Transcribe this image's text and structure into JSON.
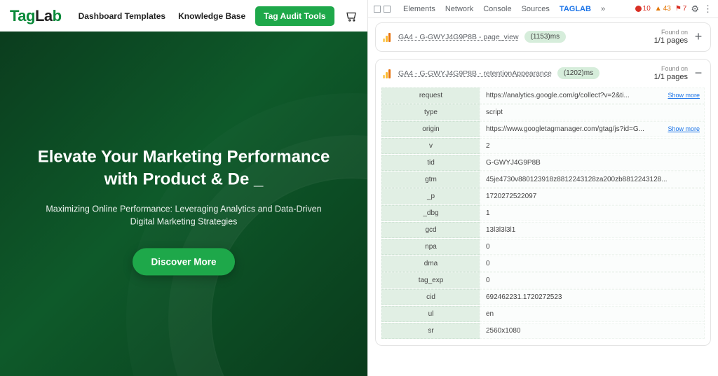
{
  "left": {
    "logo_parts": {
      "a": "Tag",
      "b": "La",
      "c": "b"
    },
    "nav": [
      {
        "label": "Dashboard Templates"
      },
      {
        "label": "Knowledge Base"
      }
    ],
    "cta": "Tag Audit Tools",
    "hero_title": "Elevate Your Marketing Performance with Product & De _",
    "hero_sub": "Maximizing Online Performance: Leveraging Analytics and Data-Driven Digital Marketing Strategies",
    "hero_btn": "Discover More"
  },
  "devtools": {
    "tabs": [
      "Elements",
      "Network",
      "Console",
      "Sources",
      "TAGLAB"
    ],
    "active_tab": 4,
    "badges": {
      "errors": "10",
      "warnings": "43",
      "issues": "7"
    }
  },
  "cards": [
    {
      "title": "GA4 - G-GWYJ4G9P8B - page_view",
      "timing": "(1153)ms",
      "found_label": "Found on",
      "found_val": "1/1 pages",
      "expanded": false
    },
    {
      "title": "GA4 - G-GWYJ4G9P8B - retentionAppearance",
      "timing": "(1202)ms",
      "found_label": "Found on",
      "found_val": "1/1 pages",
      "expanded": true,
      "rows": [
        {
          "k": "request",
          "v": "https://analytics.google.com/g/collect?v=2&ti...",
          "more": true
        },
        {
          "k": "type",
          "v": "script"
        },
        {
          "k": "origin",
          "v": "https://www.googletagmanager.com/gtag/js?id=G...",
          "more": true
        },
        {
          "k": "v",
          "v": "2"
        },
        {
          "k": "tid",
          "v": "G-GWYJ4G9P8B"
        },
        {
          "k": "gtm",
          "v": "45je4730v880123918z8812243128za200zb8812243128..."
        },
        {
          "k": "_p",
          "v": "1720272522097"
        },
        {
          "k": "_dbg",
          "v": "1"
        },
        {
          "k": "gcd",
          "v": "13l3l3l3l1"
        },
        {
          "k": "npa",
          "v": "0"
        },
        {
          "k": "dma",
          "v": "0"
        },
        {
          "k": "tag_exp",
          "v": "0"
        },
        {
          "k": "cid",
          "v": "692462231.1720272523"
        },
        {
          "k": "ul",
          "v": "en"
        },
        {
          "k": "sr",
          "v": "2560x1080"
        }
      ]
    }
  ],
  "labels": {
    "show_more": "Show more"
  }
}
